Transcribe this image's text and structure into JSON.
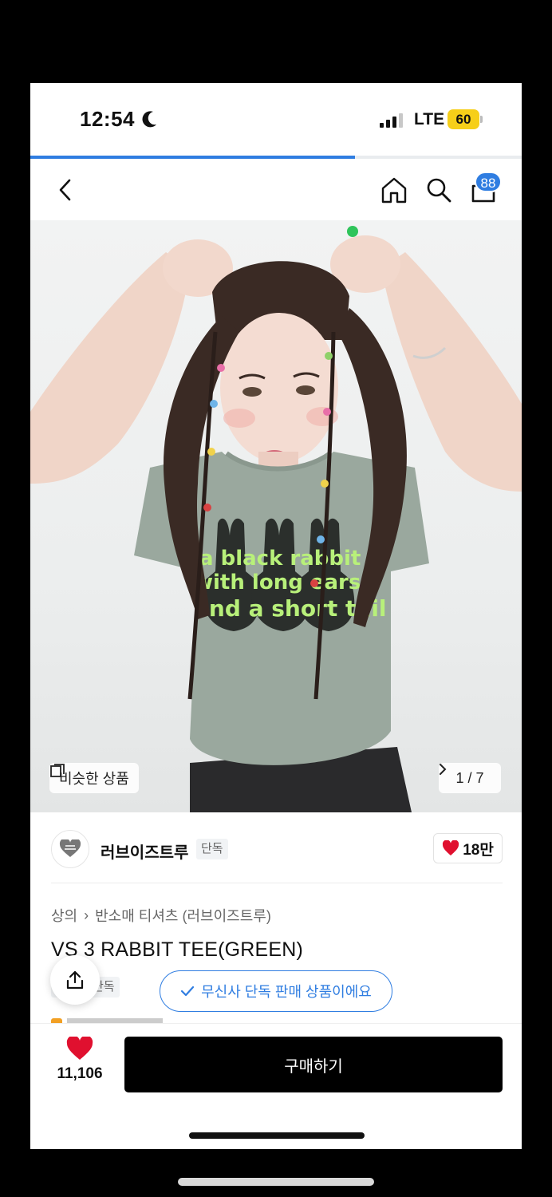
{
  "status_bar": {
    "time": "12:54",
    "network": "LTE",
    "battery": "60"
  },
  "page_load_progress": 0.66,
  "nav": {
    "cart_count": "88"
  },
  "hero": {
    "shirt_text": [
      "a black rabbit",
      "with long ears",
      "and a short tail"
    ],
    "similar_label": "비슷한 상품",
    "page_indicator": "1 / 7"
  },
  "brand": {
    "name": "러브이즈트루",
    "tag": "단독",
    "likes": "18만"
  },
  "product": {
    "breadcrumb": [
      "상의",
      "반소매 티셔츠 (러브이즈트루)"
    ],
    "title": "VS 3 RABBIT TEE(GREEN)",
    "exclusive_tag": "단독",
    "exclusive_notice": "무신사 단독 판매 상품이에요"
  },
  "bottom": {
    "wish_count": "11,106",
    "buy_label": "구매하기"
  },
  "colors": {
    "accent": "#2f7de1",
    "heart": "#e0102f",
    "battery": "#f6cf19",
    "buy_bg": "#000000"
  },
  "icons": [
    "moon-icon",
    "signal-icon",
    "back-icon",
    "home-icon",
    "search-icon",
    "cart-icon",
    "similar-icon",
    "chevron-right-icon",
    "heart-icon",
    "share-icon",
    "check-icon"
  ]
}
